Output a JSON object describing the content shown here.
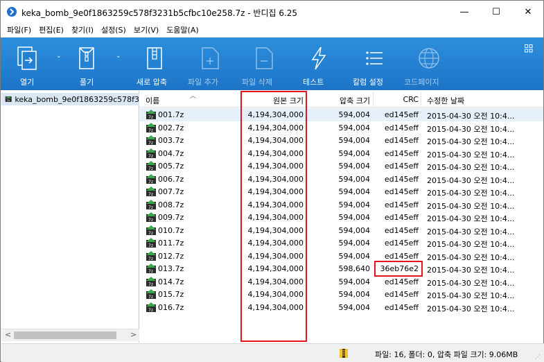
{
  "window": {
    "title": "keka_bomb_9e0f1863259c578f3231b5cfbc10e258.7z - 반디집 6.25",
    "minimize": "—",
    "maximize": "☐",
    "close": "✕"
  },
  "menu": [
    "파일(F)",
    "편집(E)",
    "찾기(I)",
    "설정(S)",
    "보기(V)",
    "도움말(A)"
  ],
  "toolbar": {
    "open": "열기",
    "extract": "풀기",
    "new_archive": "새로 압축",
    "add_file": "파일 추가",
    "delete_file": "파일 삭제",
    "test": "테스트",
    "columns": "칼럼 설정",
    "codepage": "코드페이지"
  },
  "tree": {
    "root": "keka_bomb_9e0f1863259c578f3"
  },
  "columns": {
    "name": "이름",
    "original_size": "원본 크기",
    "compressed_size": "압축 크기",
    "crc": "CRC",
    "modified": "수정한 날짜"
  },
  "files": [
    {
      "name": "001.7z",
      "orig": "4,194,304,000",
      "comp": "594,004",
      "crc": "ed145eff",
      "date": "2015-04-30 오전 10:4..."
    },
    {
      "name": "002.7z",
      "orig": "4,194,304,000",
      "comp": "594,004",
      "crc": "ed145eff",
      "date": "2015-04-30 오전 10:4..."
    },
    {
      "name": "003.7z",
      "orig": "4,194,304,000",
      "comp": "594,004",
      "crc": "ed145eff",
      "date": "2015-04-30 오전 10:4..."
    },
    {
      "name": "004.7z",
      "orig": "4,194,304,000",
      "comp": "594,004",
      "crc": "ed145eff",
      "date": "2015-04-30 오전 10:4..."
    },
    {
      "name": "005.7z",
      "orig": "4,194,304,000",
      "comp": "594,004",
      "crc": "ed145eff",
      "date": "2015-04-30 오전 10:4..."
    },
    {
      "name": "006.7z",
      "orig": "4,194,304,000",
      "comp": "594,004",
      "crc": "ed145eff",
      "date": "2015-04-30 오전 10:4..."
    },
    {
      "name": "007.7z",
      "orig": "4,194,304,000",
      "comp": "594,004",
      "crc": "ed145eff",
      "date": "2015-04-30 오전 10:4..."
    },
    {
      "name": "008.7z",
      "orig": "4,194,304,000",
      "comp": "594,004",
      "crc": "ed145eff",
      "date": "2015-04-30 오전 10:4..."
    },
    {
      "name": "009.7z",
      "orig": "4,194,304,000",
      "comp": "594,004",
      "crc": "ed145eff",
      "date": "2015-04-30 오전 10:4..."
    },
    {
      "name": "010.7z",
      "orig": "4,194,304,000",
      "comp": "594,004",
      "crc": "ed145eff",
      "date": "2015-04-30 오전 10:4..."
    },
    {
      "name": "011.7z",
      "orig": "4,194,304,000",
      "comp": "594,004",
      "crc": "ed145eff",
      "date": "2015-04-30 오전 10:4..."
    },
    {
      "name": "012.7z",
      "orig": "4,194,304,000",
      "comp": "594,004",
      "crc": "ed145eff",
      "date": "2015-04-30 오전 10:4..."
    },
    {
      "name": "013.7z",
      "orig": "4,194,304,000",
      "comp": "598,640",
      "crc": "36eb76e2",
      "date": "2015-04-30 오전 10:4..."
    },
    {
      "name": "014.7z",
      "orig": "4,194,304,000",
      "comp": "594,004",
      "crc": "ed145eff",
      "date": "2015-04-30 오전 10:4..."
    },
    {
      "name": "015.7z",
      "orig": "4,194,304,000",
      "comp": "594,004",
      "crc": "ed145eff",
      "date": "2015-04-30 오전 10:4..."
    },
    {
      "name": "016.7z",
      "orig": "4,194,304,000",
      "comp": "594,004",
      "crc": "ed145eff",
      "date": "2015-04-30 오전 10:4..."
    }
  ],
  "status": {
    "text": "파일: 16, 폴더: 0, 압축 파일 크기: 9.06MB"
  },
  "colors": {
    "toolbar": "#1d74c7",
    "highlight": "#e3141d",
    "selection": "#e5f0fb"
  }
}
